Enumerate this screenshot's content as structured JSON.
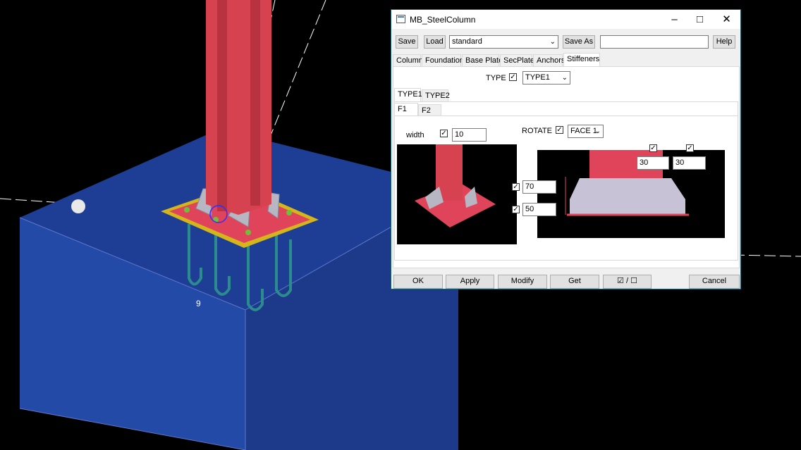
{
  "scene": {
    "dimension_label": "9"
  },
  "dialog": {
    "title": "MB_SteelColumn",
    "toolbar": {
      "save": "Save",
      "load": "Load",
      "preset": "standard",
      "save_as": "Save As",
      "save_as_name": "",
      "help": "Help"
    },
    "tabs": [
      "Column",
      "Foundation",
      "Base Plate",
      "SecPlate",
      "Anchors",
      "Stiffeners"
    ],
    "type": {
      "label": "TYPE",
      "checked": true,
      "value": "TYPE1"
    },
    "type_tabs": [
      "TYPE1",
      "TYPE2"
    ],
    "face_tabs": [
      "F1",
      "F2"
    ],
    "width": {
      "label": "width",
      "checked": true,
      "value": "10"
    },
    "rotate": {
      "label": "ROTATE",
      "checked": true,
      "value": "FACE 1"
    },
    "dims": {
      "h1": "70",
      "h2": "50",
      "w1": "30",
      "w2": "30"
    },
    "bottom_buttons": {
      "ok": "OK",
      "apply": "Apply",
      "modify": "Modify",
      "get": "Get",
      "toggle": "☑ / ☐",
      "cancel": "Cancel"
    }
  }
}
